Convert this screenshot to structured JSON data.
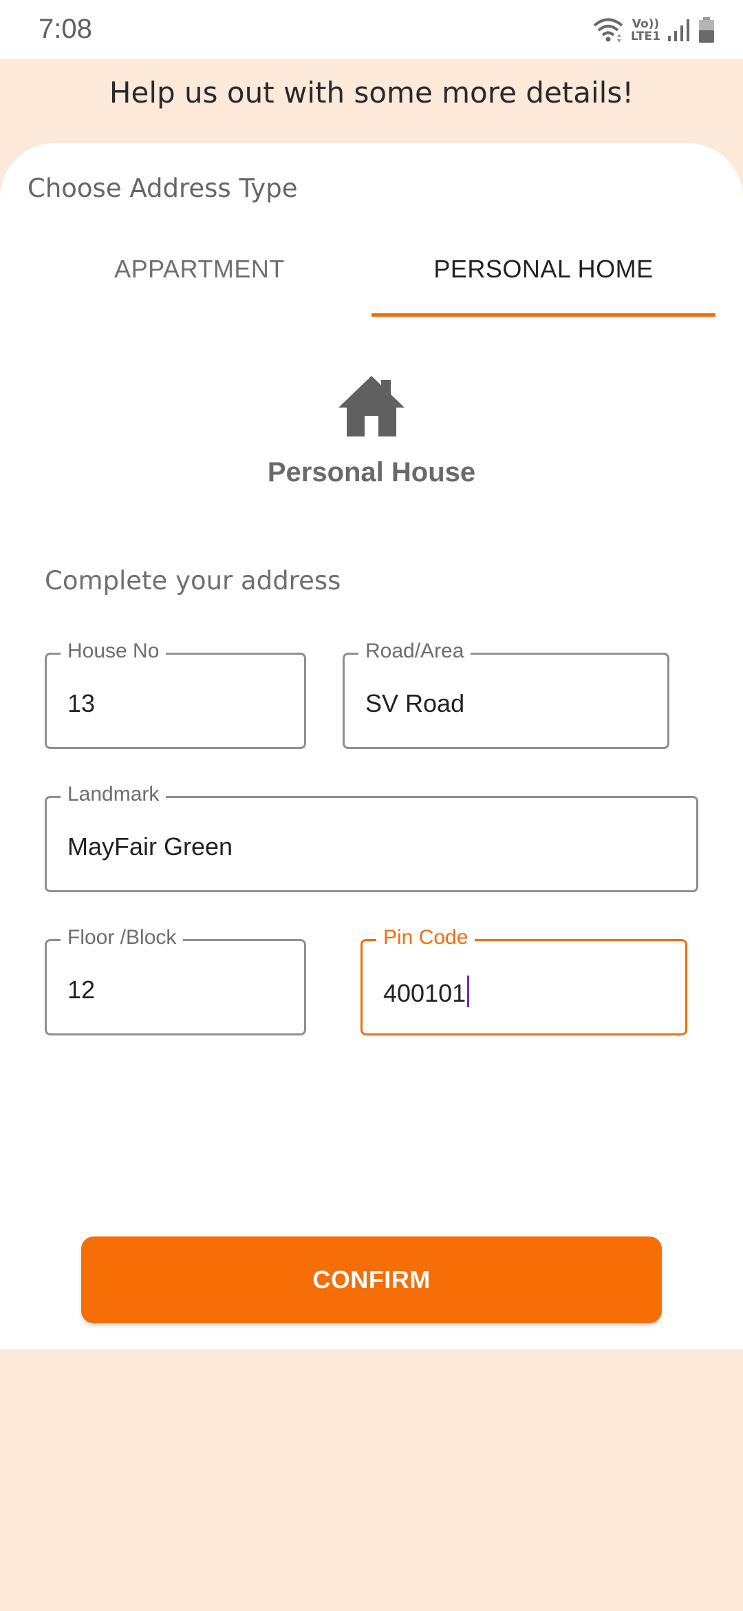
{
  "status_bar": {
    "time": "7:08",
    "lte_top": "Vo))",
    "lte_bottom": "LTE1"
  },
  "header": {
    "title": "Help us out with some more details!"
  },
  "address_type": {
    "label": "Choose Address Type",
    "tabs": [
      {
        "label": "APPARTMENT",
        "selected": false
      },
      {
        "label": "PERSONAL HOME",
        "selected": true
      }
    ],
    "selected_caption": "Personal House",
    "selected_icon": "house-icon"
  },
  "form": {
    "title": "Complete your address",
    "house_no": {
      "label": "House No",
      "value": "13"
    },
    "road_area": {
      "label": "Road/Area",
      "value": "SV Road"
    },
    "landmark": {
      "label": "Landmark",
      "value": "MayFair Green"
    },
    "floor_block": {
      "label": "Floor /Block",
      "value": "12"
    },
    "pin_code": {
      "label": "Pin Code",
      "value": "400101"
    }
  },
  "confirm_label": "CONFIRM",
  "colors": {
    "accent": "#f56e06",
    "background": "#fce9da",
    "caret": "#5b2bd6"
  }
}
